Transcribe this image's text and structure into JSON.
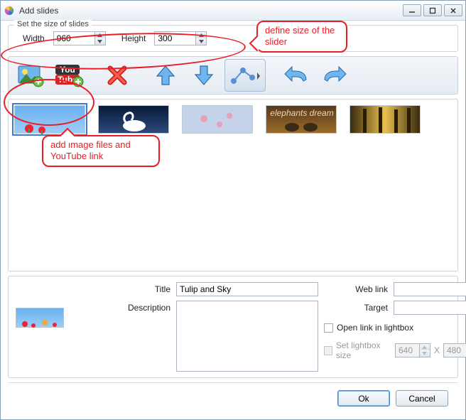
{
  "title": "Add slides",
  "size_row": {
    "legend": "Set the size of slides",
    "width_label": "Width",
    "height_label": "Height",
    "width": "960",
    "height": "300"
  },
  "toolbar": {
    "add_image": "add-image",
    "add_youtube": "add-youtube",
    "delete": "delete",
    "move_up": "move-up",
    "move_down": "move-down",
    "transitions": "transitions",
    "undo": "undo",
    "redo": "redo"
  },
  "thumbs": [
    {
      "name": "tulip-and-sky",
      "selected": true
    },
    {
      "name": "swan"
    },
    {
      "name": "clouds-pattern"
    },
    {
      "name": "elephants-dream"
    },
    {
      "name": "forest-light"
    }
  ],
  "detail": {
    "labels": {
      "title": "Title",
      "description": "Description",
      "web_link": "Web link",
      "target": "Target",
      "open_in_lightbox": "Open link in lightbox",
      "set_lightbox_size": "Set lightbox size"
    },
    "title_value": "Tulip and Sky",
    "description_value": "",
    "web_link_value": "",
    "target_value": "",
    "open_in_lightbox": false,
    "lightbox_w": "640",
    "lightbox_h": "480",
    "x_sep": "X"
  },
  "footer": {
    "ok": "Ok",
    "cancel": "Cancel"
  },
  "callouts": {
    "c1": "define size of the slider",
    "c2": "add image files and YouTube link"
  }
}
